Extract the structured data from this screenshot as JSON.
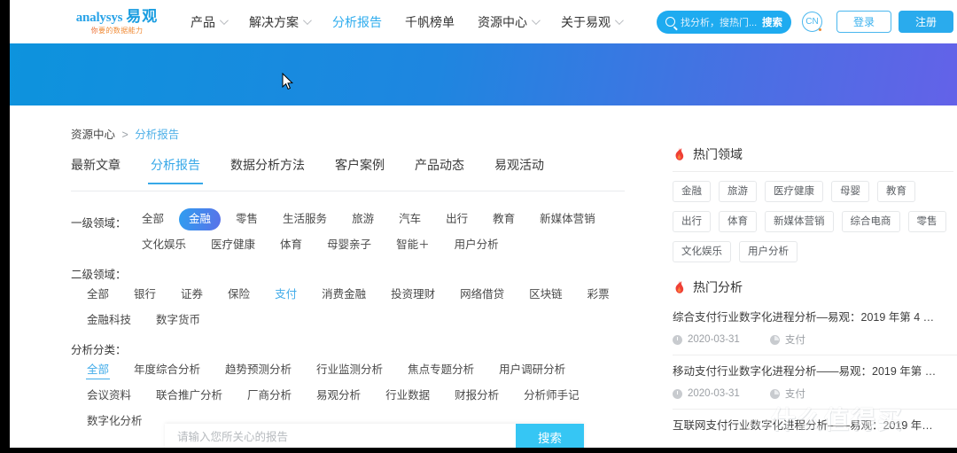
{
  "brand": {
    "logo_latin": "analysys",
    "logo_cn": "易观",
    "tagline_first": "你",
    "tagline_rest": "要的数据能力"
  },
  "header": {
    "nav": [
      {
        "label": "产品",
        "has_caret": true,
        "active": false
      },
      {
        "label": "解决方案",
        "has_caret": true,
        "active": false
      },
      {
        "label": "分析报告",
        "has_caret": false,
        "active": true
      },
      {
        "label": "千帆榜单",
        "has_caret": false,
        "active": false
      },
      {
        "label": "资源中心",
        "has_caret": true,
        "active": false
      },
      {
        "label": "关于易观",
        "has_caret": true,
        "active": false
      }
    ],
    "search_placeholder": "找分析，搜热门...",
    "search_button": "搜索",
    "language": "CN",
    "login": "登录",
    "register": "注册"
  },
  "breadcrumb": {
    "root": "资源中心",
    "separator": ">",
    "current": "分析报告"
  },
  "tabs": [
    {
      "label": "最新文章",
      "active": false
    },
    {
      "label": "分析报告",
      "active": true
    },
    {
      "label": "数据分析方法",
      "active": false
    },
    {
      "label": "客户案例",
      "active": false
    },
    {
      "label": "产品动态",
      "active": false
    },
    {
      "label": "易观活动",
      "active": false
    }
  ],
  "filters": {
    "primary": {
      "label": "一级领域：",
      "items": [
        {
          "label": "全部",
          "state": "none"
        },
        {
          "label": "金融",
          "state": "pill"
        },
        {
          "label": "零售",
          "state": "none"
        },
        {
          "label": "生活服务",
          "state": "none"
        },
        {
          "label": "旅游",
          "state": "none"
        },
        {
          "label": "汽车",
          "state": "none"
        },
        {
          "label": "出行",
          "state": "none"
        },
        {
          "label": "教育",
          "state": "none"
        },
        {
          "label": "新媒体营销",
          "state": "none"
        },
        {
          "label": "文化娱乐",
          "state": "none"
        },
        {
          "label": "医疗健康",
          "state": "none"
        },
        {
          "label": "体育",
          "state": "none"
        },
        {
          "label": "母婴亲子",
          "state": "none"
        },
        {
          "label": "智能＋",
          "state": "none"
        },
        {
          "label": "用户分析",
          "state": "none"
        }
      ]
    },
    "secondary": {
      "label": "二级领域：",
      "items": [
        {
          "label": "全部",
          "state": "none"
        },
        {
          "label": "银行",
          "state": "none"
        },
        {
          "label": "证券",
          "state": "none"
        },
        {
          "label": "保险",
          "state": "none"
        },
        {
          "label": "支付",
          "state": "text"
        },
        {
          "label": "消费金融",
          "state": "none"
        },
        {
          "label": "投资理财",
          "state": "none"
        },
        {
          "label": "网络借贷",
          "state": "none"
        },
        {
          "label": "区块链",
          "state": "none"
        },
        {
          "label": "彩票",
          "state": "none"
        },
        {
          "label": "金融科技",
          "state": "none"
        },
        {
          "label": "数字货币",
          "state": "none"
        }
      ]
    },
    "category": {
      "label": "分析分类：",
      "items": [
        {
          "label": "全部",
          "state": "underline"
        },
        {
          "label": "年度综合分析",
          "state": "none"
        },
        {
          "label": "趋势预测分析",
          "state": "none"
        },
        {
          "label": "行业监测分析",
          "state": "none"
        },
        {
          "label": "焦点专题分析",
          "state": "none"
        },
        {
          "label": "用户调研分析",
          "state": "none"
        },
        {
          "label": "会议资料",
          "state": "none"
        },
        {
          "label": "联合推广分析",
          "state": "none"
        },
        {
          "label": "厂商分析",
          "state": "none"
        },
        {
          "label": "易观分析",
          "state": "none"
        },
        {
          "label": "行业数据",
          "state": "none"
        },
        {
          "label": "财报分析",
          "state": "none"
        },
        {
          "label": "分析师手记",
          "state": "none"
        },
        {
          "label": "数字化分析",
          "state": "none"
        }
      ]
    }
  },
  "bottom_search": {
    "placeholder": "请输入您所关心的报告",
    "button": "搜索",
    "value": ""
  },
  "sidebar": {
    "hot_domains": {
      "title": "热门领域",
      "icon": "flame-icon",
      "tags": [
        "金融",
        "旅游",
        "医疗健康",
        "母婴",
        "教育",
        "出行",
        "体育",
        "新媒体营销",
        "综合电商",
        "零售",
        "文化娱乐",
        "用户分析"
      ]
    },
    "hot_analysis": {
      "title": "热门分析",
      "icon": "flame-icon",
      "items": [
        {
          "title": "综合支付行业数字化进程分析—易观：2019 年第 4 …",
          "date": "2020-03-31",
          "tag": "支付"
        },
        {
          "title": "移动支付行业数字化进程分析——易观：2019 年第 …",
          "date": "2020-03-31",
          "tag": "支付"
        },
        {
          "title": "互联网支付行业数字化进程分析——易观：2019 年…",
          "date": "",
          "tag": ""
        }
      ]
    }
  },
  "watermark": {
    "mark": "值",
    "text": "什么值得买"
  },
  "colors": {
    "accent_blue": "#37a8e8",
    "register_blue": "#2aabed",
    "search_cyan": "#36c6f4",
    "banner_start": "#0d93dd",
    "banner_end": "#6362e8",
    "flame_red": "#ef3f35",
    "pill_gradient_start": "#2f9ef0",
    "pill_gradient_end": "#5a71e8",
    "logo_orange": "#f08a34"
  }
}
